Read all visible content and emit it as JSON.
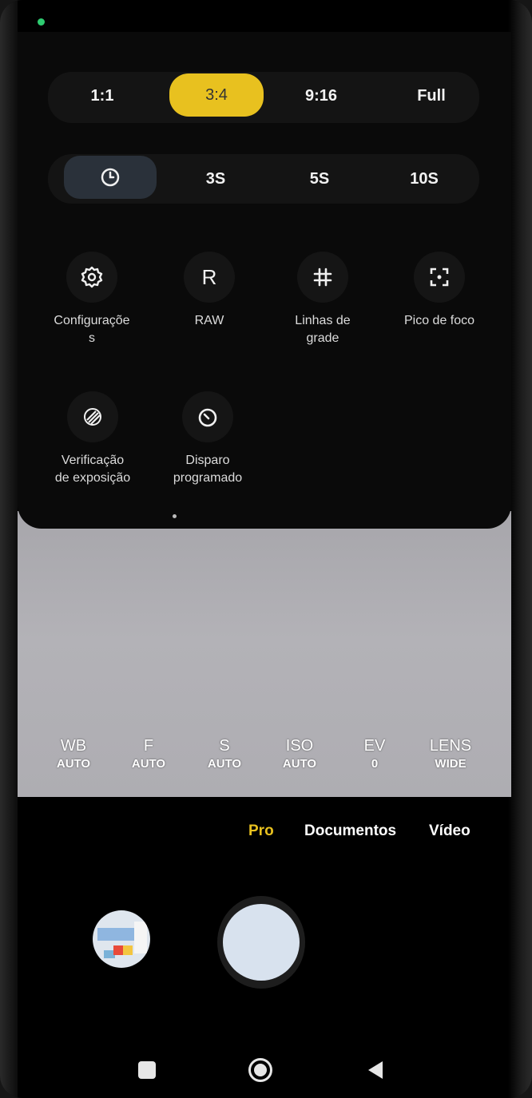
{
  "aspect_ratio": {
    "options": [
      "1:1",
      "3:4",
      "9:16",
      "Full"
    ],
    "selected": "3:4"
  },
  "timer": {
    "off_icon": "clock-icon",
    "options": [
      "3S",
      "5S",
      "10S"
    ]
  },
  "tools": {
    "settings_label": "Configuraçõe\ns",
    "raw_icon_letter": "R",
    "raw_label": "RAW",
    "grid_label": "Linhas de\ngrade",
    "focus_peaking_label": "Pico de foco",
    "exposure_label": "Verificação\nde exposição",
    "timed_label": "Disparo\nprogramado"
  },
  "pro_params": [
    {
      "key": "WB",
      "value": "AUTO"
    },
    {
      "key": "F",
      "value": "AUTO"
    },
    {
      "key": "S",
      "value": "AUTO"
    },
    {
      "key": "ISO",
      "value": "AUTO"
    },
    {
      "key": "EV",
      "value": "0"
    },
    {
      "key": "LENS",
      "value": "WIDE"
    }
  ],
  "modes": {
    "active": "Pro",
    "documents": "Documentos",
    "video": "Vídeo"
  },
  "colors": {
    "accent": "#e8c11f",
    "panel": "#0a0a0a"
  },
  "nav": {
    "recent_icon": "recent-apps-icon",
    "home_icon": "home-icon",
    "back_icon": "back-icon"
  }
}
